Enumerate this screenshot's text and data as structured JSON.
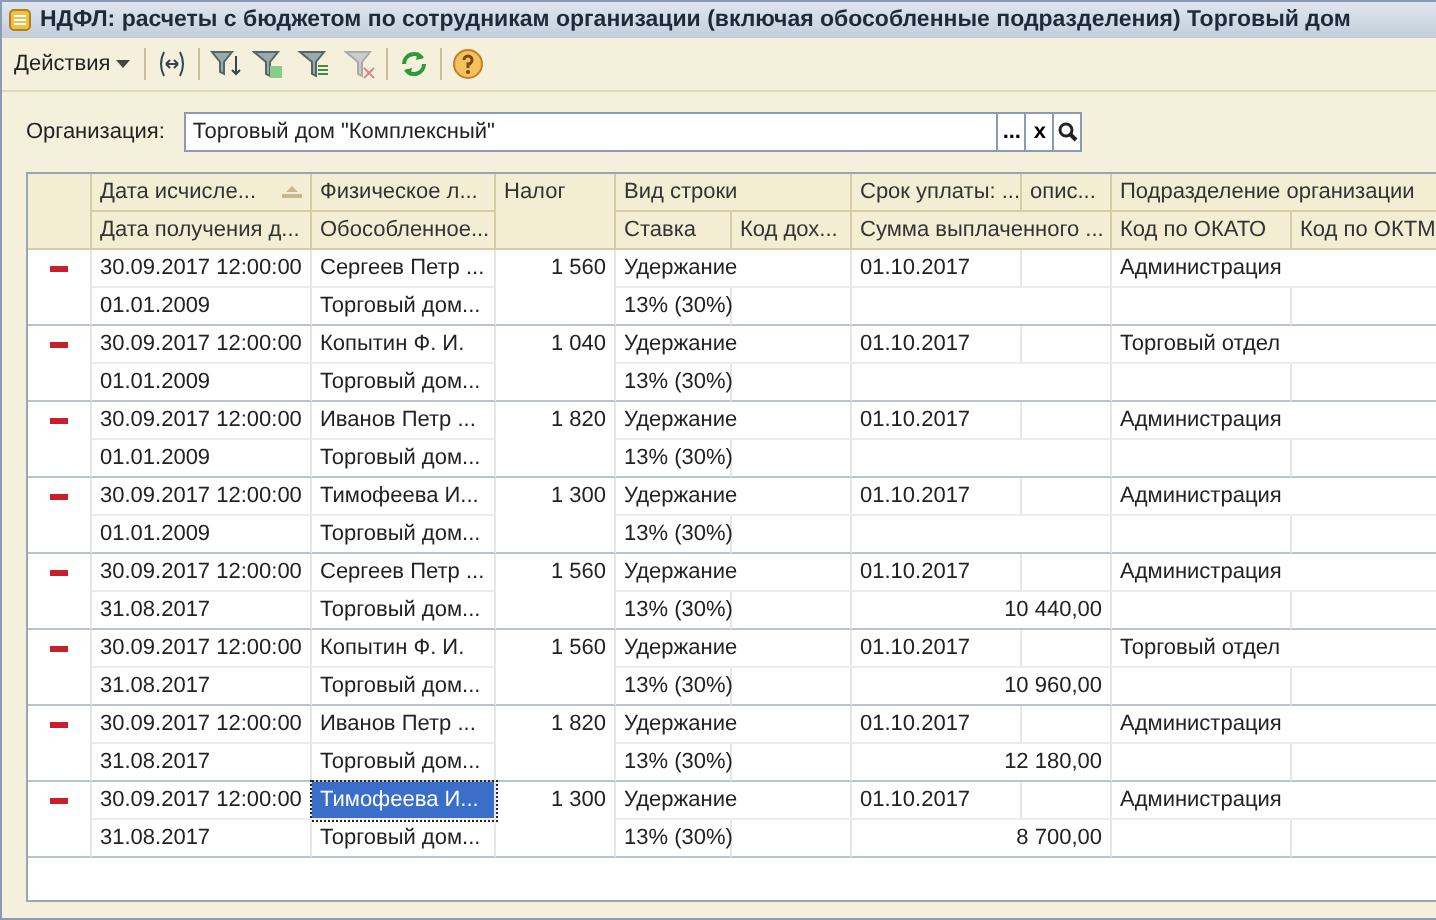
{
  "window": {
    "title": "НДФЛ: расчеты с бюджетом по сотрудникам организации (включая обособленные подразделения) Торговый дом"
  },
  "toolbar": {
    "actions_menu": "Действия"
  },
  "organization": {
    "label": "Организация:",
    "value": "Торговый дом \"Комплексный\"",
    "select_button": "...",
    "clear_button": "x"
  },
  "table": {
    "columns_top": [
      "Дата исчисле...",
      "Физическое л...",
      "Налог",
      "Вид строки",
      "Срок уплаты: ...",
      "опис...",
      "Подразделение организации"
    ],
    "columns_bottom": [
      "Дата получения д...",
      "Обособленное...",
      "Ставка",
      "Код дох...",
      "Сумма выплаченного ...",
      "Код по ОКАТО",
      "Код по ОКТМ"
    ],
    "rows": [
      {
        "date": "30.09.2017 12:00:00",
        "person": "Сергеев Петр ...",
        "tax": "1 560",
        "kind": "Удержание",
        "due": "01.10.2017",
        "division": "Администрация",
        "income_date": "01.01.2009",
        "branch": "Торговый дом...",
        "rate": "13% (30%)",
        "paid": "",
        "selected": false
      },
      {
        "date": "30.09.2017 12:00:00",
        "person": "Копытин Ф. И.",
        "tax": "1 040",
        "kind": "Удержание",
        "due": "01.10.2017",
        "division": "Торговый отдел",
        "income_date": "01.01.2009",
        "branch": "Торговый дом...",
        "rate": "13% (30%)",
        "paid": "",
        "selected": false
      },
      {
        "date": "30.09.2017 12:00:00",
        "person": "Иванов  Петр ...",
        "tax": "1 820",
        "kind": "Удержание",
        "due": "01.10.2017",
        "division": "Администрация",
        "income_date": "01.01.2009",
        "branch": "Торговый дом...",
        "rate": "13% (30%)",
        "paid": "",
        "selected": false
      },
      {
        "date": "30.09.2017 12:00:00",
        "person": "Тимофеева И...",
        "tax": "1 300",
        "kind": "Удержание",
        "due": "01.10.2017",
        "division": "Администрация",
        "income_date": "01.01.2009",
        "branch": "Торговый дом...",
        "rate": "13% (30%)",
        "paid": "",
        "selected": false
      },
      {
        "date": "30.09.2017 12:00:00",
        "person": "Сергеев Петр ...",
        "tax": "1 560",
        "kind": "Удержание",
        "due": "01.10.2017",
        "division": "Администрация",
        "income_date": "31.08.2017",
        "branch": "Торговый дом...",
        "rate": "13% (30%)",
        "paid": "10 440,00",
        "selected": false
      },
      {
        "date": "30.09.2017 12:00:00",
        "person": "Копытин Ф. И.",
        "tax": "1 560",
        "kind": "Удержание",
        "due": "01.10.2017",
        "division": "Торговый отдел",
        "income_date": "31.08.2017",
        "branch": "Торговый дом...",
        "rate": "13% (30%)",
        "paid": "10 960,00",
        "selected": false
      },
      {
        "date": "30.09.2017 12:00:00",
        "person": "Иванов  Петр ...",
        "tax": "1 820",
        "kind": "Удержание",
        "due": "01.10.2017",
        "division": "Администрация",
        "income_date": "31.08.2017",
        "branch": "Торговый дом...",
        "rate": "13% (30%)",
        "paid": "12 180,00",
        "selected": false
      },
      {
        "date": "30.09.2017 12:00:00",
        "person": "Тимофеева И...",
        "tax": "1 300",
        "kind": "Удержание",
        "due": "01.10.2017",
        "division": "Администрация",
        "income_date": "31.08.2017",
        "branch": "Торговый дом...",
        "rate": "13% (30%)",
        "paid": "8 700,00",
        "selected": true
      }
    ]
  }
}
